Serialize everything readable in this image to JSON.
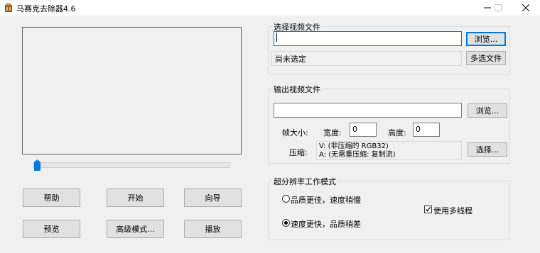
{
  "window": {
    "title": "马赛克去除器4.6"
  },
  "input_group": {
    "title": "选择视频文件",
    "path_value": "",
    "browse_label": "浏览...",
    "status_text": "尚未选定",
    "multi_select_label": "多选文件"
  },
  "output_group": {
    "title": "输出视频文件",
    "path_value": "",
    "browse_label": "浏览...",
    "frame_size_label": "帧大小:",
    "width_label": "宽度:",
    "width_value": "0",
    "height_label": "高度:",
    "height_value": "0",
    "compression_label": "压缩:",
    "compression_line1": "V: (非压缩的 RGB32)",
    "compression_line2": "A: (无需重压缩: 复制流)",
    "select_label": "选择..."
  },
  "mode_group": {
    "title": "超分辨率工作模式",
    "option_quality": "品质更佳，速度稍慢",
    "option_speed": "速度更快，品质稍差",
    "selected_option": "option_speed",
    "multithread_label": "使用多线程",
    "multithread_checked": true
  },
  "preview": {
    "slider_position": 0
  },
  "buttons": {
    "help": "帮助",
    "start": "开始",
    "wizard": "向导",
    "preview": "预览",
    "advanced": "高级模式...",
    "play": "播放"
  }
}
